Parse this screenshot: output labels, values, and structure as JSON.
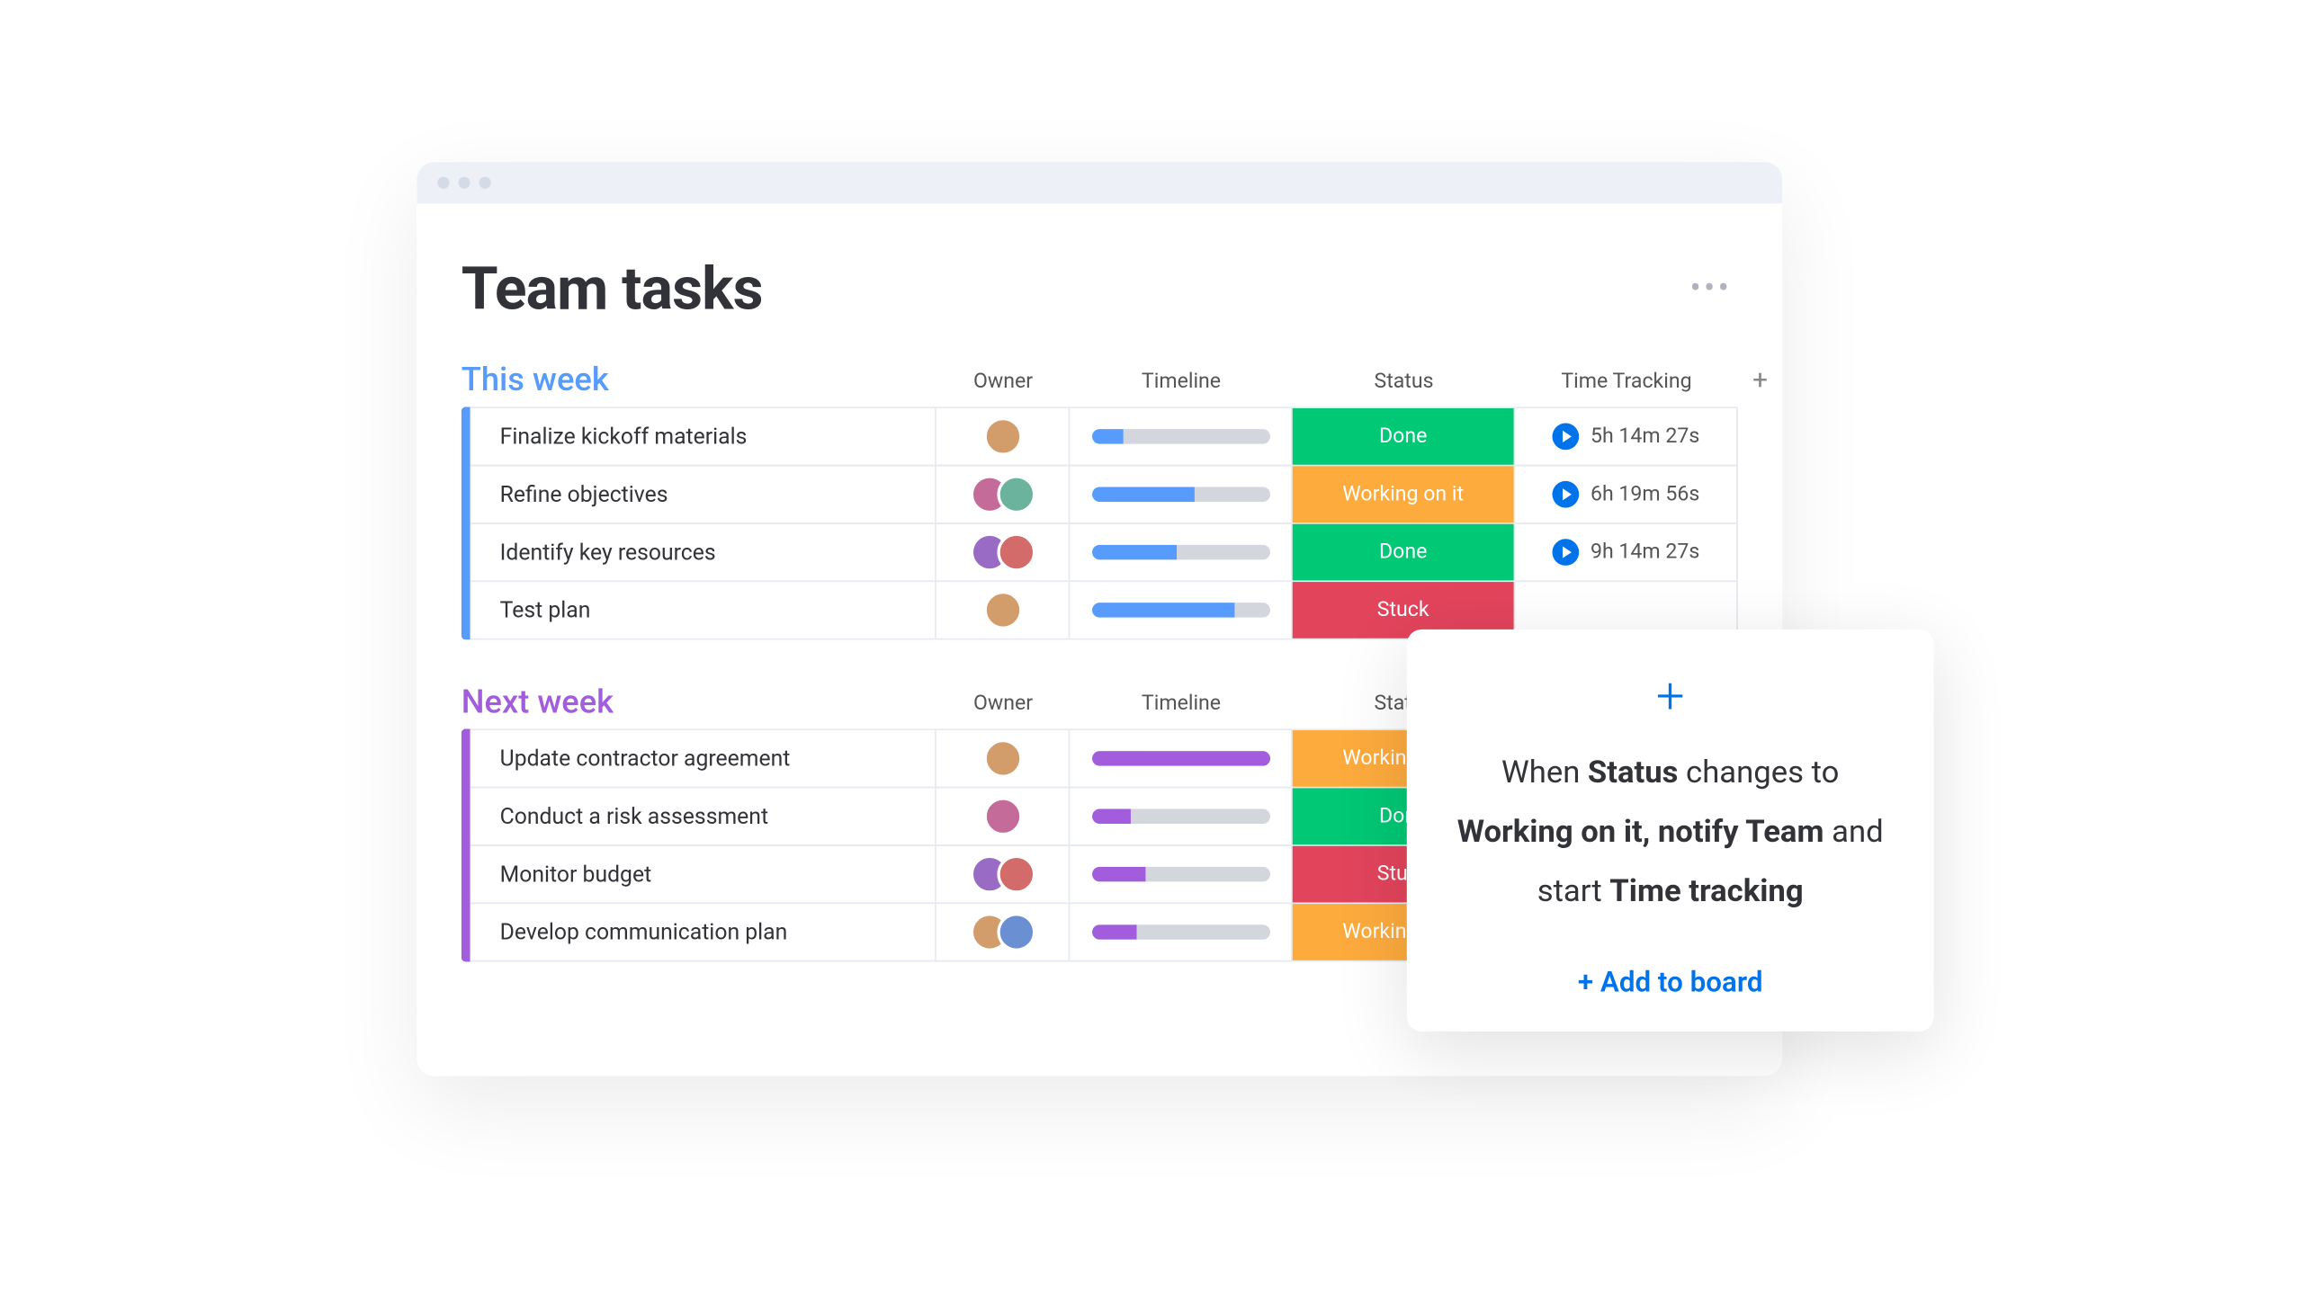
{
  "title": "Team tasks",
  "columns": [
    "Owner",
    "Timeline",
    "Status",
    "Time Tracking"
  ],
  "status_labels": {
    "done": "Done",
    "working": "Working on it",
    "stuck": "Stuck"
  },
  "avatarColors": [
    "#d39c6b",
    "#6b8fd3",
    "#c46b9a",
    "#6bb39d",
    "#9a6bc4",
    "#d36b6b"
  ],
  "groups": [
    {
      "title": "This week",
      "color": "blue",
      "rows": [
        {
          "name": "Finalize kickoff materials",
          "owners": 1,
          "progress": 18,
          "status": "done",
          "time": "5h 14m 27s"
        },
        {
          "name": "Refine objectives",
          "owners": 2,
          "progress": 58,
          "status": "working",
          "time": "6h 19m 56s"
        },
        {
          "name": "Identify key resources",
          "owners": 2,
          "progress": 48,
          "status": "done",
          "time": "9h 14m 27s"
        },
        {
          "name": "Test plan",
          "owners": 1,
          "progress": 80,
          "status": "stuck",
          "time": ""
        }
      ]
    },
    {
      "title": "Next week",
      "color": "purple",
      "rows": [
        {
          "name": "Update contractor agreement",
          "owners": 1,
          "progress": 100,
          "status": "working",
          "time": ""
        },
        {
          "name": "Conduct a risk assessment",
          "owners": 1,
          "progress": 22,
          "status": "done",
          "time": ""
        },
        {
          "name": "Monitor budget",
          "owners": 2,
          "progress": 30,
          "status": "stuck",
          "time": ""
        },
        {
          "name": "Develop communication plan",
          "owners": 2,
          "progress": 25,
          "status": "working",
          "time": ""
        }
      ]
    }
  ],
  "automation": {
    "text_parts": [
      "When ",
      "Status",
      " changes to ",
      "Working on it, notify Team",
      " and start ",
      "Time tracking"
    ],
    "cta": "+ Add to board"
  }
}
